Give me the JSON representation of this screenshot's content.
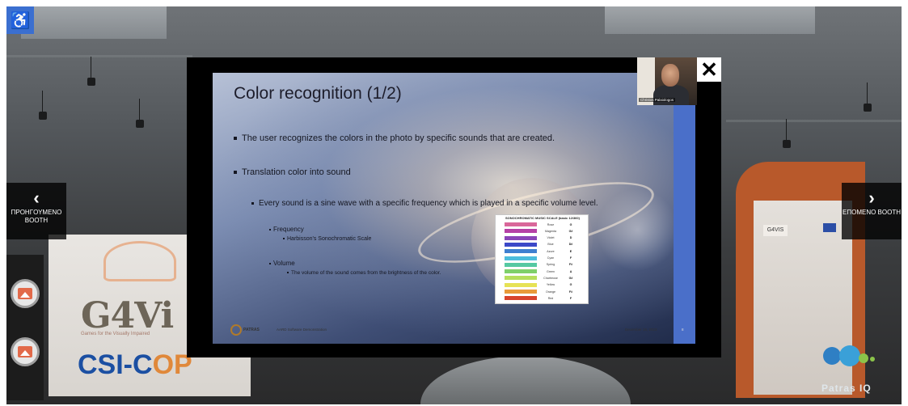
{
  "navigation": {
    "prev_label": "ΠΡΟΗΓΟΥΜΕΝΟ ΒΟΟΤΗ",
    "next_label": "ΕΠΟΜΕΝΟ ΒΟΟΤΗ",
    "prev_icon": "chevron-left-icon",
    "next_icon": "chevron-right-icon"
  },
  "accessibility": {
    "icon": "wheelchair-icon",
    "glyph": "♿"
  },
  "video": {
    "close_glyph": "✕",
    "presenter_name": "Christos Palaiologos"
  },
  "slide": {
    "title": "Color recognition (1/2)",
    "bullets": {
      "b1": "The user recognizes the colors in the photo by specific sounds that are created.",
      "b2": "Translation color into sound",
      "b3": "Every sound is a sine wave with a specific frequency which is played in a specific volume level.",
      "b4": "Frequency",
      "b5": "Harbisson's Sonochromatic Scale",
      "b6": "Volume",
      "b7": "The volume of the sound comes from the brightness of the color."
    },
    "color_table": {
      "title": "SONOCHROMATIC MUSIC SCALE (basic 12/360)",
      "rows": [
        {
          "color": "#d9679a",
          "name": "Rose",
          "note": "G"
        },
        {
          "color": "#b641a6",
          "name": "Magenta",
          "note": "G#"
        },
        {
          "color": "#8a45b8",
          "name": "Violet",
          "note": "D"
        },
        {
          "color": "#3c49c8",
          "name": "Blue",
          "note": "D#"
        },
        {
          "color": "#3f7fd0",
          "name": "Azure",
          "note": "E"
        },
        {
          "color": "#4cbcdc",
          "name": "Cyan",
          "note": "F"
        },
        {
          "color": "#55c9a2",
          "name": "Spring",
          "note": "F#"
        },
        {
          "color": "#7fd06a",
          "name": "Green",
          "note": "A"
        },
        {
          "color": "#b6de5c",
          "name": "Chartreuse",
          "note": "G#"
        },
        {
          "color": "#e6e255",
          "name": "Yellow",
          "note": "G"
        },
        {
          "color": "#e89a3a",
          "name": "Orange",
          "note": "F#"
        },
        {
          "color": "#d8432c",
          "name": "Red",
          "note": "F"
        }
      ]
    },
    "footer": {
      "university": "PATRAS",
      "text": "AARD Software Demonstration",
      "date": "December 15, 2023",
      "page": "8"
    }
  },
  "booths": {
    "left_logo": "G4Vi",
    "left_logo_sub": "Games for the Visually Impaired",
    "left_logo2_a": "CSI-C",
    "left_logo2_b": "OP",
    "right_badge": "G4VIS",
    "right_logo_text": "Patras IQ"
  },
  "colors": {
    "accent": "#3b6fd0",
    "slide_bar": "#4a6fc9",
    "booth_orange": "#b8592b"
  }
}
